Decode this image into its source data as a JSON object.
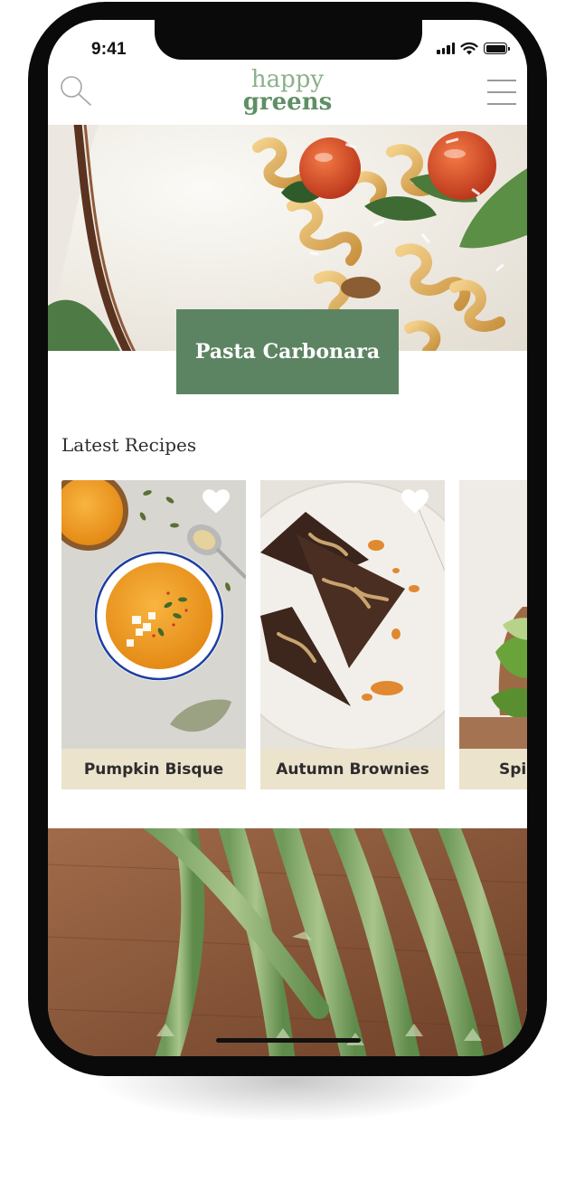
{
  "status_bar": {
    "time": "9:41"
  },
  "header": {
    "logo_line1": "happy",
    "logo_line2": "greens"
  },
  "hero": {
    "title": "Pasta Carbonara"
  },
  "latest": {
    "title": "Latest Recipes",
    "recipes": [
      {
        "name": "Pumpkin Bisque"
      },
      {
        "name": "Autumn Brownies"
      },
      {
        "name": "Spi"
      }
    ]
  },
  "icons": [
    "search-icon",
    "menu-icon",
    "heart-icon",
    "signal-icon",
    "wifi-icon",
    "battery-icon"
  ],
  "colors": {
    "brand_green": "#5c8462",
    "logo_green": "#6b9870",
    "card_label_bg": "#ece3cd",
    "text_dark": "#2d2d2d"
  }
}
